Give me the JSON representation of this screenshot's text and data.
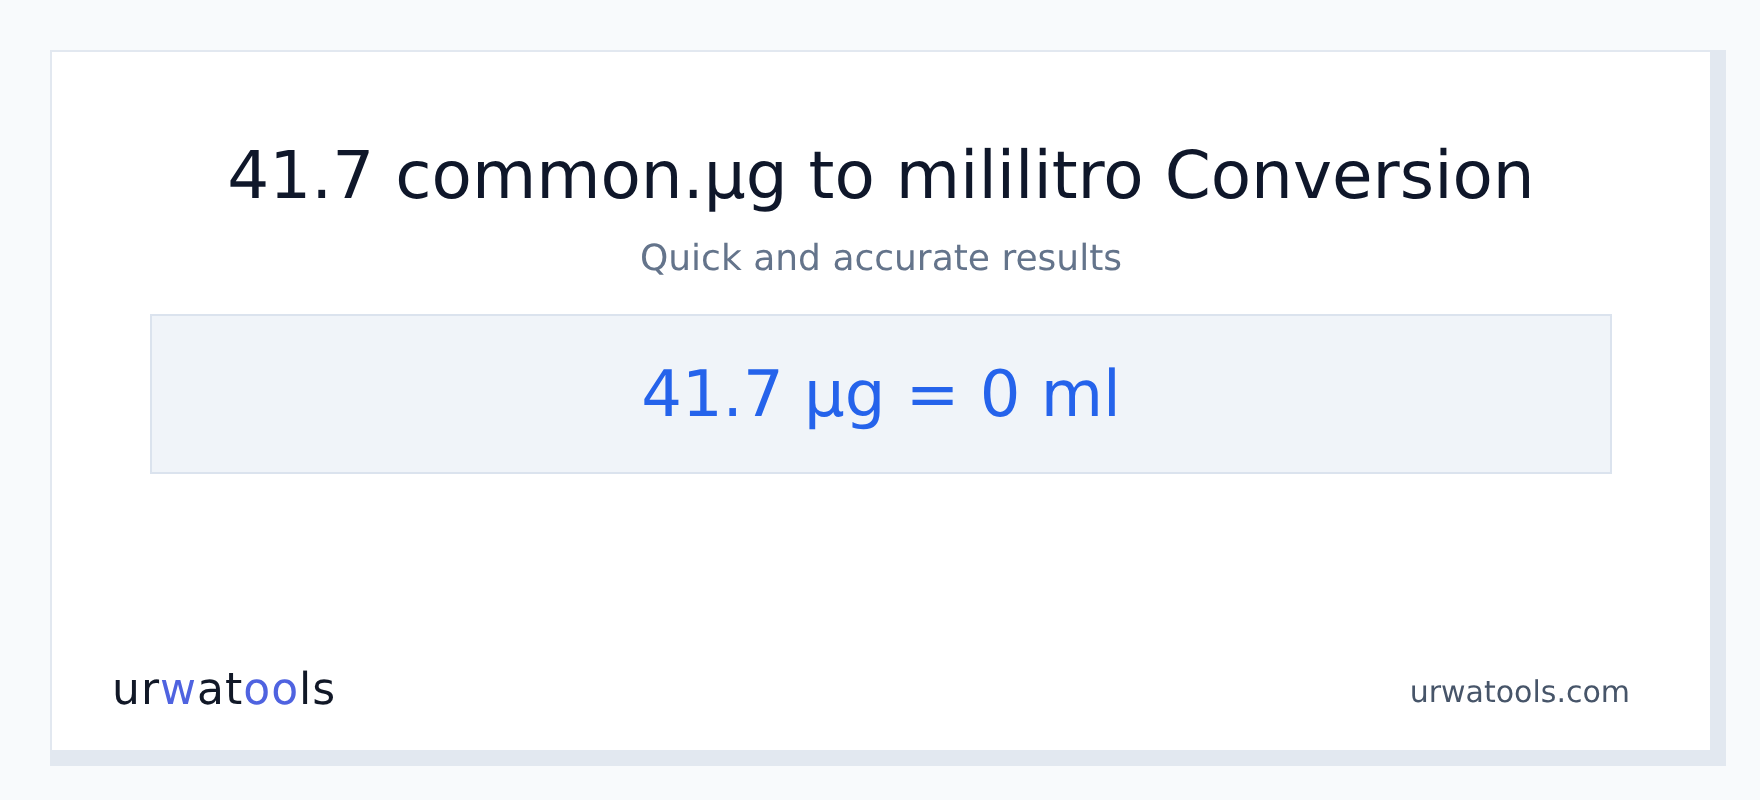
{
  "title": "41.7 common.µg to mililitro Conversion",
  "subtitle": "Quick and accurate results",
  "result": "41.7 µg = 0 ml",
  "logo": [
    {
      "text": "ur",
      "accent": false
    },
    {
      "text": "w",
      "accent": true
    },
    {
      "text": "at",
      "accent": false
    },
    {
      "text": "oo",
      "accent": true
    },
    {
      "text": "ls",
      "accent": false
    }
  ],
  "site": "urwatools.com"
}
